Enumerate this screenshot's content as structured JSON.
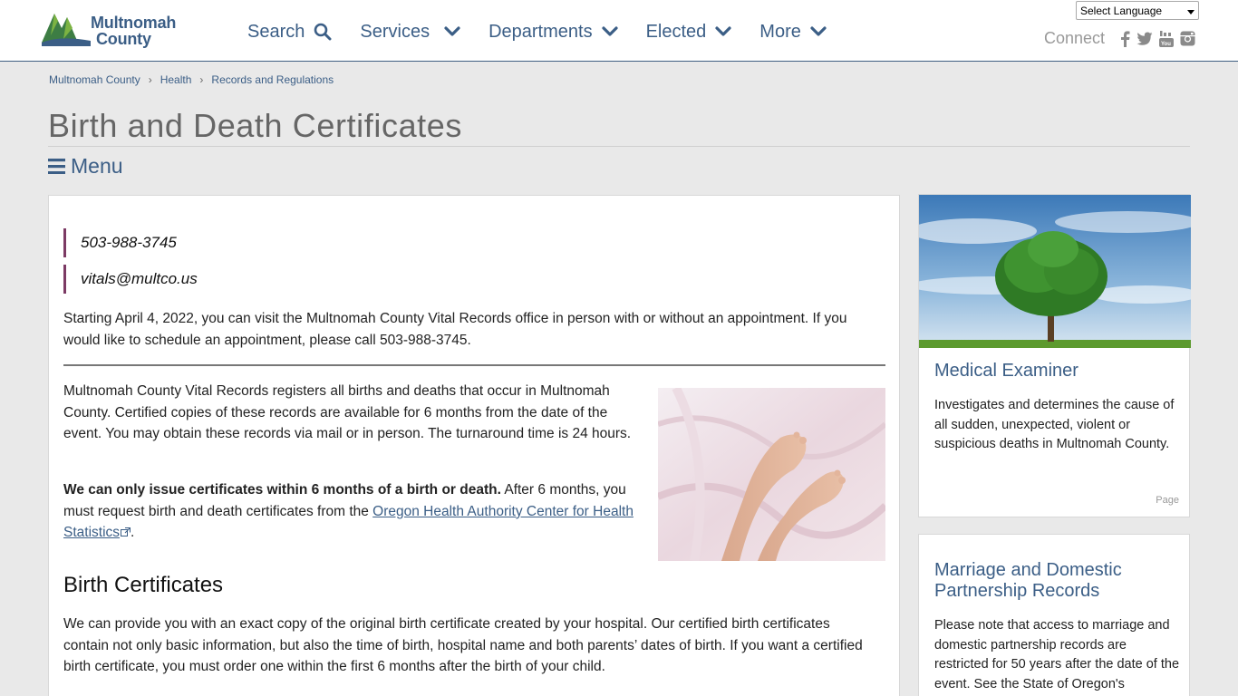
{
  "header": {
    "logo_line1": "Multnomah",
    "logo_line2": "County",
    "nav": [
      {
        "label": "Search",
        "icon": "search-icon"
      },
      {
        "label": "Services",
        "icon": "chevron-down-icon"
      },
      {
        "label": "Departments",
        "icon": "chevron-down-icon"
      },
      {
        "label": "Elected",
        "icon": "chevron-down-icon"
      },
      {
        "label": "More",
        "icon": "chevron-down-icon"
      }
    ],
    "language_select": "Select Language",
    "connect_label": "Connect",
    "social": [
      "facebook-icon",
      "twitter-icon",
      "youtube-icon",
      "instagram-icon"
    ]
  },
  "breadcrumb": [
    "Multnomah County",
    "Health",
    "Records and Regulations"
  ],
  "page_title": "Birth and Death Certificates",
  "menu_label": "Menu",
  "main": {
    "phone": "503-988-3745",
    "email": "vitals@multco.us",
    "notice": "Starting April 4, 2022, you can visit the Multnomah County Vital Records office in person with or without an appointment. If you would like to schedule an appointment, please call 503-988-3745.",
    "intro": "Multnomah County Vital Records registers all births and deaths that occur in Multnomah County. Certified copies of these records are available for 6 months from the date of the event. You may obtain these records via mail or in person. The turnaround time is 24 hours.",
    "limit_bold": "We can only issue certificates within 6 months of a birth or death.",
    "limit_text": " After 6 months, you must request birth and death certificates from the ",
    "limit_link": "Oregon Health Authority Center for Health Statistics",
    "limit_end": ".",
    "birth_heading": "Birth Certificates",
    "birth_text": "We can provide you with an exact copy of the original birth certificate created by your hospital. Our certified birth certificates contain not only basic information, but also the time of birth, hospital name and both parents’ dates of birth. If you want a certified birth certificate, you must order one within the first 6 months after the birth of your child."
  },
  "sidebar": [
    {
      "title": "Medical Examiner",
      "text": "Investigates and determines the cause of all sudden, unexpected, violent or suspicious deaths in Multnomah County.",
      "type": "Page"
    },
    {
      "title": "Marriage and Domestic Partnership Records",
      "text": "Please note that access to marriage and domestic partnership records are restricted for 50 years after the date of the event. See the State of Oregon's"
    }
  ],
  "colors": {
    "brand": "#3b5e86",
    "accent_bar": "#7c3a64",
    "background": "#e9e9e9"
  }
}
